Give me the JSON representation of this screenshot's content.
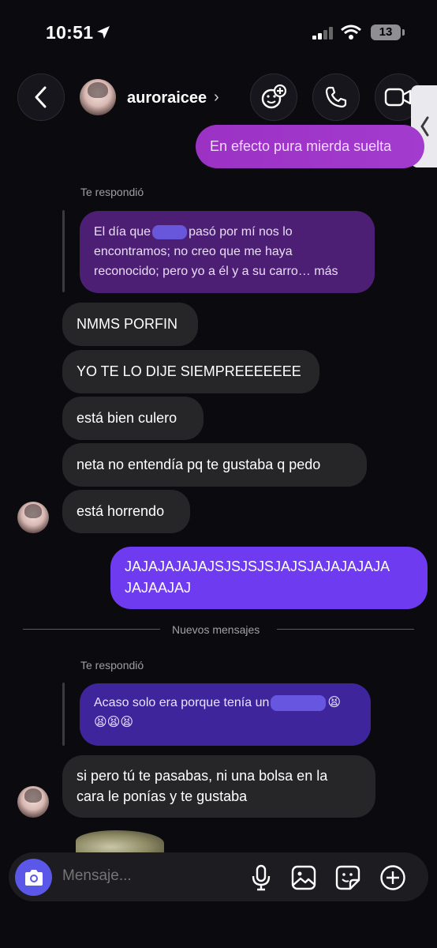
{
  "status_bar": {
    "time": "10:51",
    "battery": "13"
  },
  "header": {
    "username": "auroraicee"
  },
  "messages": {
    "top_sent": "En efecto pura mierda suelta",
    "reply_label_1": "Te respondió",
    "quoted_1": "El día que [redactado] pasó por mí nos lo encontramos; no creo que me haya reconocido; pero yo a él y a su carro… más",
    "quoted_1_part_a": "El día que",
    "quoted_1_part_b": "pasó por mí nos lo",
    "quoted_1_line2": "encontramos; no creo que me haya",
    "quoted_1_line3": "reconocido; pero yo a él y a su carro… más",
    "in_1": "NMMS PORFIN",
    "in_2": "YO TE LO DIJE SIEMPREEEEEEE",
    "in_3": "está bien culero",
    "in_4": "neta no entendía pq te gustaba q pedo",
    "in_5": "está horrendo",
    "out_laugh_line1": "JAJAJAJAJAJSJSJSJSJAJSJAJAJAJAJA",
    "out_laugh_line2": "JAJAAJAJ",
    "divider": "Nuevos mensajes",
    "reply_label_2": "Te respondió",
    "quoted_2_line1": "Acaso solo era porque tenía un",
    "quoted_2_emoji_a": "😫",
    "quoted_2_emoji_b": "😫😫😫",
    "in_6_line1": "si pero tú te pasabas, ni una bolsa en la",
    "in_6_line2": "cara le ponías y te gustaba"
  },
  "composer": {
    "placeholder": "Mensaje..."
  },
  "colors": {
    "accent_outgoing": "#6f3bf0",
    "camera_button": "#5b57e8",
    "incoming_bubble": "#262629"
  },
  "icons": [
    "location-arrow-icon",
    "cellular-signal-icon",
    "wifi-icon",
    "battery-icon",
    "back-chevron-icon",
    "add-people-icon",
    "phone-icon",
    "video-camera-icon",
    "camera-icon",
    "microphone-icon",
    "gallery-icon",
    "sticker-icon",
    "plus-circle-icon"
  ]
}
